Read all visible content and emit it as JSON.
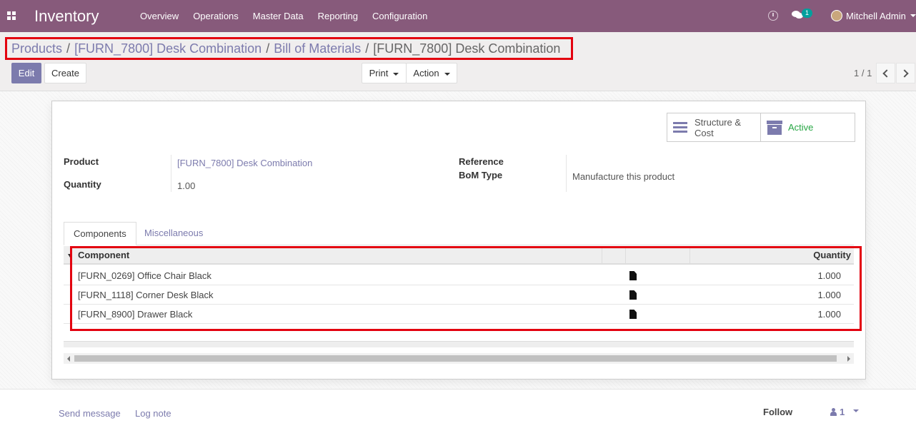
{
  "navbar": {
    "app_title": "Inventory",
    "menu": [
      "Overview",
      "Operations",
      "Master Data",
      "Reporting",
      "Configuration"
    ],
    "chat_badge": "1",
    "user_name": "Mitchell Admin",
    "brand_color": "#875a7b"
  },
  "breadcrumb": {
    "items": [
      "Products",
      "[FURN_7800] Desk Combination",
      "Bill of Materials"
    ],
    "active": "[FURN_7800] Desk Combination",
    "separator": "/"
  },
  "toolbar": {
    "edit_label": "Edit",
    "create_label": "Create",
    "print_label": "Print",
    "action_label": "Action",
    "pager": "1 / 1"
  },
  "smart_buttons": {
    "structure_line1": "Structure &",
    "structure_line2": "Cost",
    "active_label": "Active"
  },
  "fields": {
    "product_label": "Product",
    "product_value": "[FURN_7800] Desk Combination",
    "quantity_label": "Quantity",
    "quantity_value": "1.00",
    "reference_label": "Reference",
    "bom_type_label": "BoM Type",
    "bom_type_value": "Manufacture this product"
  },
  "tabs": [
    "Components",
    "Miscellaneous"
  ],
  "components_table": {
    "headers": {
      "component": "Component",
      "quantity": "Quantity"
    },
    "rows": [
      {
        "component": "[FURN_0269] Office Chair Black",
        "quantity": "1.000"
      },
      {
        "component": "[FURN_1118] Corner Desk Black",
        "quantity": "1.000"
      },
      {
        "component": "[FURN_8900] Drawer Black",
        "quantity": "1.000"
      }
    ]
  },
  "chatter": {
    "send_message": "Send message",
    "log_note": "Log note",
    "follow": "Follow",
    "followers_count": "1"
  },
  "colors": {
    "accent": "#7c7bad",
    "highlight": "#e3000f",
    "active_green": "#28a745"
  }
}
